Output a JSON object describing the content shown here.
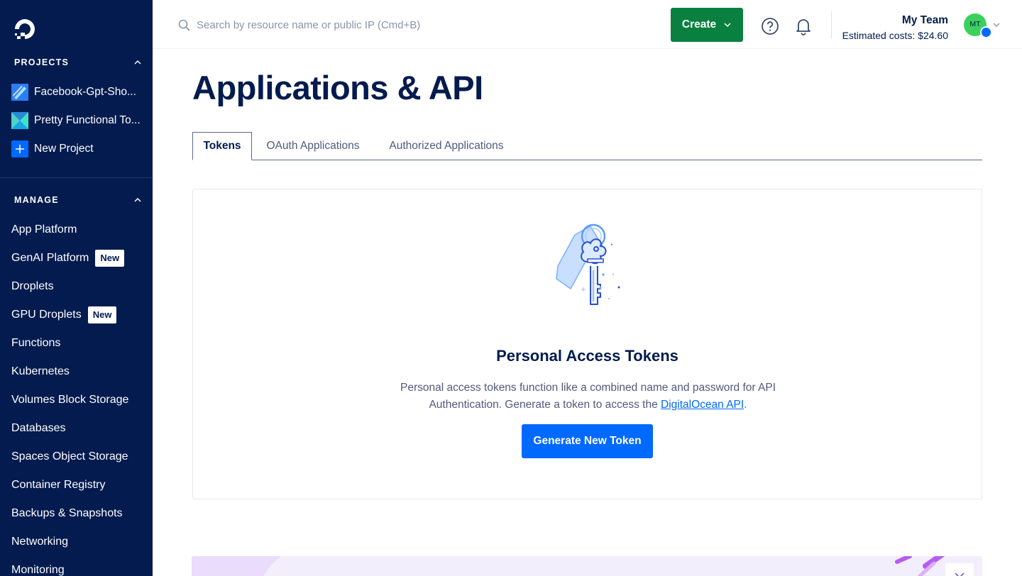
{
  "search": {
    "placeholder": "Search by resource name or public IP (Cmd+B)"
  },
  "header": {
    "create_label": "Create",
    "team_name": "My Team",
    "estimated_costs": "Estimated costs: $24.60",
    "avatar_initials": "MT"
  },
  "sidebar": {
    "projects_heading": "PROJECTS",
    "projects": [
      {
        "label": "Facebook-Gpt-Sho...",
        "icon": "project-stripe-icon"
      },
      {
        "label": "Pretty Functional To...",
        "icon": "project-x-icon"
      },
      {
        "label": "New Project",
        "icon": "plus-icon"
      }
    ],
    "manage_heading": "MANAGE",
    "items": [
      {
        "label": "App Platform"
      },
      {
        "label": "GenAI Platform",
        "badge": "New"
      },
      {
        "label": "Droplets"
      },
      {
        "label": "GPU Droplets",
        "badge": "New"
      },
      {
        "label": "Functions"
      },
      {
        "label": "Kubernetes"
      },
      {
        "label": "Volumes Block Storage"
      },
      {
        "label": "Databases"
      },
      {
        "label": "Spaces Object Storage"
      },
      {
        "label": "Container Registry"
      },
      {
        "label": "Backups & Snapshots"
      },
      {
        "label": "Networking"
      },
      {
        "label": "Monitoring"
      }
    ]
  },
  "main": {
    "title": "Applications & API",
    "tabs": [
      {
        "label": "Tokens",
        "active": true
      },
      {
        "label": "OAuth Applications",
        "active": false
      },
      {
        "label": "Authorized Applications",
        "active": false
      }
    ],
    "card": {
      "title": "Personal Access Tokens",
      "desc_before": "Personal access tokens function like a combined name and password for API Authentication. Generate a token to access the ",
      "link": "DigitalOcean API",
      "desc_after": ".",
      "button": "Generate New Token"
    }
  },
  "colors": {
    "sidebar_bg": "#031b4e",
    "create_green": "#0a8040",
    "primary_blue": "#0069ff"
  }
}
